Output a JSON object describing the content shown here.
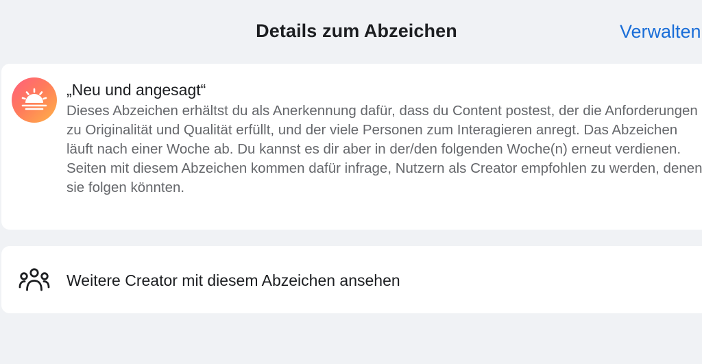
{
  "header": {
    "title": "Details zum Abzeichen",
    "manage_label": "Verwalten"
  },
  "badge": {
    "icon": "sunrise-icon",
    "title": "„Neu und angesagt“",
    "description": "Dieses Abzeichen erhältst du als Anerkennung dafür, dass du Content postest, der die Anforderungen zu Originalität und Qualität erfüllt, und der viele Personen zum Interagieren anregt. Das Abzeichen läuft nach einer Woche ab. Du kannst es dir aber in der/den folgenden Woche(n) erneut verdienen. Seiten mit diesem Abzeichen kommen dafür infrage, Nutzern als Creator empfohlen zu werden, denen sie folgen könnten."
  },
  "creators_link": {
    "icon": "people-group-icon",
    "label": "Weitere Creator mit diesem Abzeichen ansehen"
  },
  "colors": {
    "background": "#f0f2f5",
    "card": "#ffffff",
    "link_blue": "#1a6ed8",
    "secondary_text": "#65676b",
    "badge_gradient_start": "#ff5f7e",
    "badge_gradient_end": "#ffb347"
  }
}
